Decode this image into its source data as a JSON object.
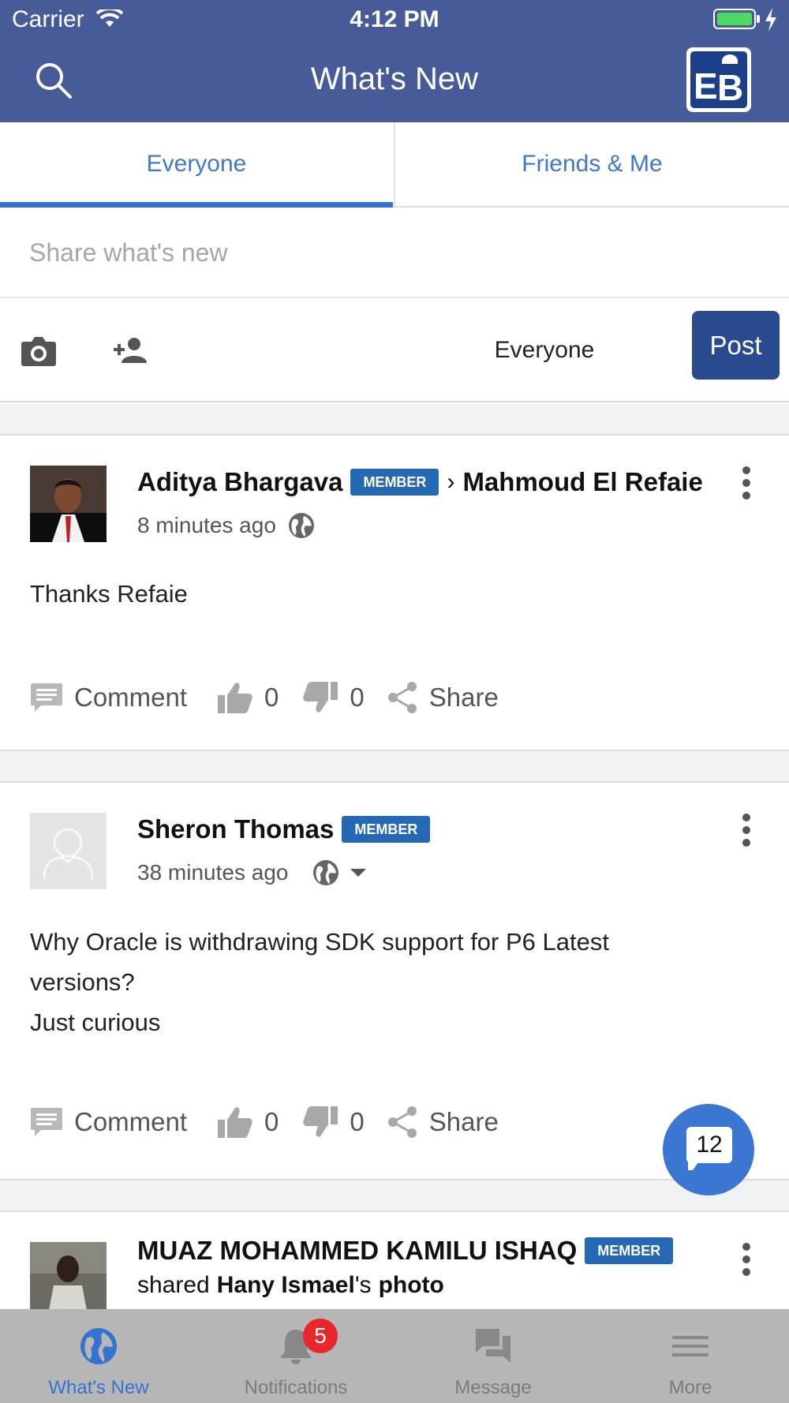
{
  "status_bar": {
    "carrier": "Carrier",
    "time": "4:12 PM"
  },
  "header": {
    "title": "What's New",
    "logo_icon": "eb-helmet-logo"
  },
  "tabs": [
    {
      "label": "Everyone",
      "active": true
    },
    {
      "label": "Friends & Me",
      "active": false
    }
  ],
  "composer": {
    "placeholder": "Share what's new",
    "privacy": "Everyone",
    "post_label": "Post"
  },
  "posts": [
    {
      "author": "Aditya Bhargava",
      "badge": "MEMBER",
      "target": "Mahmoud El Refaie",
      "time": "8 minutes ago",
      "body_lines": [
        "Thanks Refaie"
      ],
      "comment_label": "Comment",
      "likes": "0",
      "dislikes": "0",
      "share_label": "Share"
    },
    {
      "author": "Sheron Thomas",
      "badge": "MEMBER",
      "time": "38 minutes ago",
      "body_lines": [
        "Why Oracle is withdrawing SDK support for P6 Latest",
        "versions?",
        "Just curious"
      ],
      "comment_label": "Comment",
      "likes": "0",
      "dislikes": "0",
      "share_label": "Share"
    },
    {
      "author": "MUAZ MOHAMMED KAMILU ISHAQ",
      "badge": "MEMBER",
      "shared_prefix": "shared",
      "shared_owner": "Hany Ismael",
      "shared_suffix": "'s",
      "shared_object": "photo"
    }
  ],
  "chat_fab": {
    "count": "12"
  },
  "tabbar": [
    {
      "label": "What's New",
      "icon": "globe-icon",
      "active": true
    },
    {
      "label": "Notifications",
      "icon": "bell-icon",
      "badge": "5"
    },
    {
      "label": "Message",
      "icon": "chat-bubbles-icon"
    },
    {
      "label": "More",
      "icon": "hamburger-menu-icon"
    }
  ],
  "colors": {
    "header_bg": "#475b98",
    "accent_blue": "#3573d0",
    "post_button": "#2a4a8f",
    "member_badge": "#2568b3",
    "notification_badge": "#e8262b",
    "tabbar_bg": "#b6b6b6"
  }
}
